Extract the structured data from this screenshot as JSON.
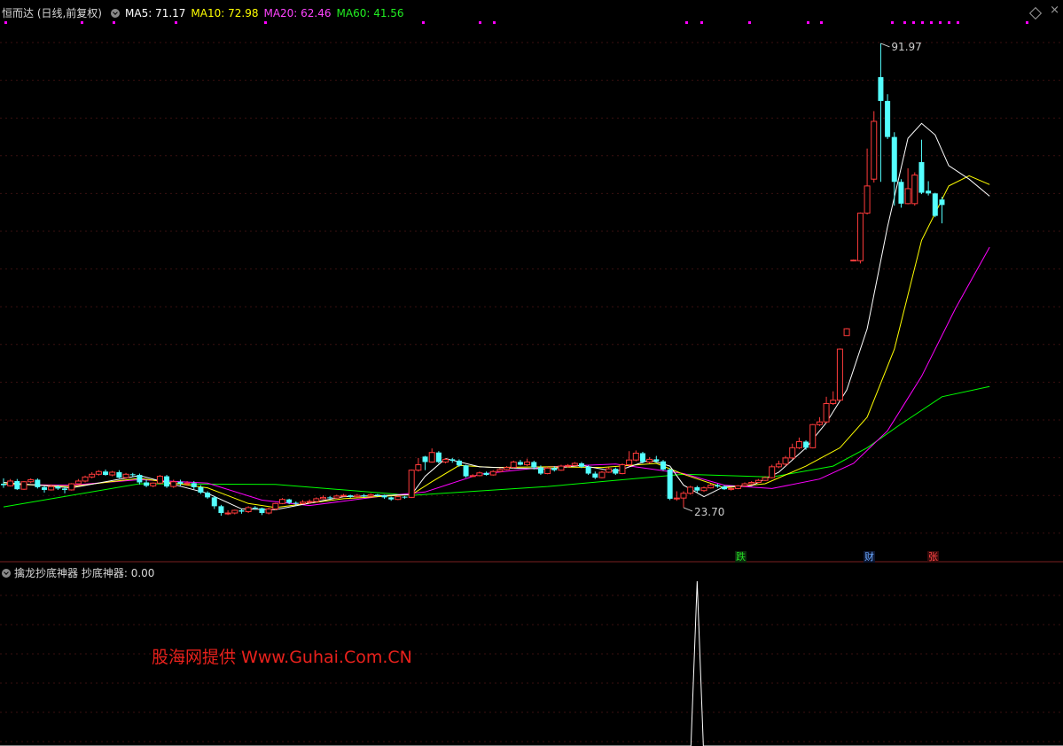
{
  "header": {
    "symbol_label": "恒而达 (日线,前复权)",
    "ma5": "MA5: 71.17",
    "ma10": "MA10: 72.98",
    "ma20": "MA20: 62.46",
    "ma60": "MA60: 41.56"
  },
  "sub_header": {
    "indicator_label": "擒龙抄底神器",
    "indicator_value": "抄底神器: 0.00"
  },
  "annotations": {
    "high_label": "91.97",
    "low_label": "23.70"
  },
  "events": [
    {
      "label": "跌",
      "color": "green"
    },
    {
      "label": "财",
      "color": "blue"
    },
    {
      "label": "张",
      "color": "red"
    }
  ],
  "watermark": "股海网提供 Www.Guhai.Com.CN",
  "icons": [
    "collapse-circle-icon",
    "diamond-icon",
    "close-x-icon"
  ],
  "colors": {
    "background": "#000000",
    "up_candle": "#ff3b3b",
    "down_candle": "#54ffff",
    "ma5": "#ffffff",
    "ma10": "#ffff00",
    "ma20": "#ff00ff",
    "ma60": "#00ff00",
    "indicator": "#ffffff",
    "marker": "#ff00ff"
  },
  "chart_data": {
    "type": "candlestick",
    "y_range": [
      16,
      96
    ],
    "high": 91.97,
    "low": 23.7,
    "candles": [
      [
        27.2,
        27.0,
        28.0,
        26.6
      ],
      [
        26.9,
        27.6,
        27.9,
        26.8
      ],
      [
        27.6,
        26.4,
        27.9,
        26.3
      ],
      [
        26.4,
        27.5,
        27.6,
        26.3
      ],
      [
        27.5,
        27.8,
        28.0,
        27.3
      ],
      [
        27.8,
        26.7,
        28.0,
        26.5
      ],
      [
        26.7,
        26.3,
        26.9,
        25.9
      ],
      [
        26.3,
        26.8,
        27.1,
        26.2
      ],
      [
        26.8,
        26.5,
        27.0,
        26.3
      ],
      [
        26.5,
        26.3,
        26.8,
        25.8
      ],
      [
        26.3,
        27.2,
        27.3,
        26.2
      ],
      [
        27.2,
        27.6,
        27.9,
        27.1
      ],
      [
        27.6,
        28.2,
        28.4,
        27.4
      ],
      [
        28.2,
        28.6,
        28.9,
        28.0
      ],
      [
        28.6,
        29.0,
        29.2,
        28.4
      ],
      [
        29.0,
        28.5,
        29.3,
        28.4
      ],
      [
        28.5,
        28.9,
        29.1,
        28.3
      ],
      [
        28.9,
        28.1,
        29.2,
        28.0
      ],
      [
        28.1,
        28.6,
        28.8,
        27.9
      ],
      [
        28.6,
        28.5,
        28.8,
        28.2
      ],
      [
        28.5,
        27.4,
        28.7,
        27.1
      ],
      [
        27.4,
        26.9,
        27.8,
        26.7
      ],
      [
        26.9,
        27.3,
        27.4,
        26.7
      ],
      [
        27.3,
        28.3,
        28.5,
        27.1
      ],
      [
        28.3,
        26.8,
        28.5,
        26.6
      ],
      [
        26.8,
        27.5,
        27.8,
        26.6
      ],
      [
        27.5,
        27.2,
        27.8,
        26.9
      ],
      [
        27.2,
        27.3,
        27.6,
        26.9
      ],
      [
        27.3,
        26.7,
        27.6,
        26.4
      ],
      [
        26.7,
        25.9,
        27.0,
        25.7
      ],
      [
        25.9,
        25.2,
        26.1,
        25.0
      ],
      [
        25.2,
        23.9,
        25.4,
        23.5
      ],
      [
        23.9,
        22.9,
        24.1,
        22.5
      ],
      [
        22.9,
        22.9,
        23.3,
        22.6
      ],
      [
        22.9,
        23.3,
        23.4,
        22.7
      ],
      [
        23.3,
        23.1,
        23.5,
        22.8
      ],
      [
        23.1,
        23.7,
        23.9,
        22.9
      ],
      [
        23.7,
        23.6,
        23.9,
        23.4
      ],
      [
        23.6,
        22.9,
        23.7,
        22.6
      ],
      [
        22.9,
        23.5,
        23.7,
        22.7
      ],
      [
        23.5,
        24.3,
        24.4,
        23.3
      ],
      [
        24.3,
        24.9,
        25.1,
        24.2
      ],
      [
        24.9,
        24.4,
        25.0,
        24.2
      ],
      [
        24.4,
        24.3,
        24.6,
        24.0
      ],
      [
        24.3,
        24.5,
        24.8,
        24.2
      ],
      [
        24.5,
        24.6,
        24.9,
        24.3
      ],
      [
        24.6,
        25.0,
        25.2,
        24.4
      ],
      [
        25.0,
        25.2,
        25.5,
        24.9
      ],
      [
        25.2,
        25.1,
        25.4,
        24.8
      ],
      [
        25.1,
        25.4,
        25.6,
        25.0
      ],
      [
        25.4,
        25.5,
        25.7,
        25.3
      ],
      [
        25.5,
        25.3,
        25.6,
        25.1
      ],
      [
        25.3,
        25.5,
        25.7,
        25.2
      ],
      [
        25.5,
        25.4,
        25.7,
        25.2
      ],
      [
        25.4,
        25.6,
        25.8,
        25.3
      ],
      [
        25.6,
        25.5,
        25.7,
        25.3
      ],
      [
        25.5,
        25.2,
        25.6,
        25.0
      ],
      [
        25.2,
        24.9,
        25.3,
        24.7
      ],
      [
        24.9,
        25.3,
        25.5,
        24.8
      ],
      [
        25.3,
        25.2,
        25.4,
        25.0
      ],
      [
        25.2,
        29.2,
        29.3,
        25.1
      ],
      [
        29.2,
        30.0,
        31.0,
        29.0
      ],
      [
        31.2,
        30.4,
        31.3,
        29.2
      ],
      [
        30.4,
        31.8,
        32.4,
        30.3
      ],
      [
        31.8,
        30.4,
        32.0,
        30.2
      ],
      [
        30.4,
        30.8,
        31.0,
        30.2
      ],
      [
        30.8,
        30.6,
        31.0,
        30.3
      ],
      [
        30.6,
        29.9,
        30.8,
        29.7
      ],
      [
        29.9,
        28.3,
        30.0,
        28.1
      ],
      [
        28.3,
        28.4,
        28.6,
        28.2
      ],
      [
        28.4,
        28.8,
        29.0,
        28.3
      ],
      [
        28.8,
        28.5,
        29.0,
        28.4
      ],
      [
        28.5,
        29.0,
        29.2,
        28.4
      ],
      [
        29.0,
        29.3,
        29.5,
        28.9
      ],
      [
        29.3,
        29.6,
        29.8,
        29.2
      ],
      [
        29.6,
        30.4,
        30.6,
        29.5
      ],
      [
        30.4,
        30.0,
        30.7,
        29.9
      ],
      [
        30.0,
        30.4,
        30.9,
        29.8
      ],
      [
        30.4,
        29.6,
        30.6,
        29.3
      ],
      [
        29.6,
        28.7,
        29.9,
        28.5
      ],
      [
        28.7,
        29.5,
        29.7,
        28.6
      ],
      [
        29.5,
        29.2,
        29.8,
        29.0
      ],
      [
        29.2,
        29.8,
        30.0,
        29.1
      ],
      [
        29.8,
        29.9,
        30.1,
        29.6
      ],
      [
        29.9,
        30.2,
        30.4,
        29.8
      ],
      [
        30.2,
        29.7,
        30.4,
        29.5
      ],
      [
        29.7,
        28.7,
        29.9,
        28.5
      ],
      [
        28.7,
        28.1,
        29.0,
        27.9
      ],
      [
        28.1,
        28.9,
        29.1,
        28.0
      ],
      [
        28.9,
        29.4,
        29.6,
        28.8
      ],
      [
        29.4,
        28.7,
        29.6,
        28.5
      ],
      [
        28.7,
        30.0,
        30.2,
        28.6
      ],
      [
        30.0,
        30.7,
        32.0,
        29.8
      ],
      [
        30.7,
        31.7,
        32.1,
        30.5
      ],
      [
        31.7,
        30.4,
        31.9,
        30.2
      ],
      [
        30.4,
        30.8,
        31.1,
        30.2
      ],
      [
        30.8,
        30.5,
        31.3,
        30.3
      ],
      [
        30.5,
        29.3,
        30.7,
        29.1
      ],
      [
        29.3,
        25.0,
        29.5,
        24.8
      ],
      [
        25.0,
        25.1,
        26.1,
        24.7
      ],
      [
        25.1,
        25.8,
        26.1,
        23.7
      ],
      [
        25.8,
        26.7,
        26.9,
        25.6
      ],
      [
        26.7,
        26.2,
        26.9,
        25.9
      ],
      [
        26.2,
        26.6,
        26.8,
        26.0
      ],
      [
        26.6,
        27.0,
        27.2,
        26.5
      ],
      [
        27.0,
        26.8,
        27.2,
        26.6
      ],
      [
        26.8,
        26.4,
        27.0,
        26.3
      ],
      [
        26.4,
        26.5,
        26.7,
        26.2
      ],
      [
        26.5,
        26.9,
        27.0,
        26.4
      ],
      [
        26.9,
        27.2,
        27.4,
        26.7
      ],
      [
        27.2,
        27.4,
        27.6,
        27.0
      ],
      [
        27.4,
        27.7,
        27.9,
        27.3
      ],
      [
        27.7,
        28.1,
        28.3,
        27.6
      ],
      [
        28.1,
        29.7,
        30.0,
        28.0
      ],
      [
        29.7,
        30.1,
        30.6,
        29.5
      ],
      [
        30.1,
        31.0,
        31.3,
        29.8
      ],
      [
        31.0,
        32.5,
        33.1,
        30.8
      ],
      [
        32.5,
        33.4,
        34.0,
        32.3
      ],
      [
        33.4,
        32.5,
        33.6,
        32.2
      ],
      [
        32.5,
        35.9,
        36.0,
        32.4
      ],
      [
        35.9,
        36.3,
        37.0,
        35.7
      ],
      [
        36.3,
        39.0,
        40.0,
        36.1
      ],
      [
        39.0,
        39.5,
        40.8,
        38.8
      ],
      [
        39.5,
        47.0,
        47.1,
        39.4
      ],
      [
        49.0,
        50.0,
        50.1,
        49.9
      ],
      [
        60.0,
        60.1,
        60.2,
        59.9
      ],
      [
        60.0,
        67.0,
        67.1,
        59.6
      ],
      [
        67.0,
        71.0,
        76.5,
        66.8
      ],
      [
        72.0,
        80.5,
        82.0,
        71.5
      ],
      [
        87.0,
        83.5,
        91.97,
        71.6
      ],
      [
        83.5,
        78.2,
        84.5,
        77.9
      ],
      [
        78.2,
        71.6,
        78.9,
        68.1
      ],
      [
        71.6,
        68.4,
        72.0,
        67.8
      ],
      [
        68.4,
        70.6,
        73.6,
        68.3
      ],
      [
        68.4,
        72.6,
        73.0,
        68.1
      ],
      [
        74.5,
        70.0,
        77.8,
        69.8
      ],
      [
        70.3,
        69.9,
        71.7,
        69.6
      ],
      [
        69.9,
        66.6,
        70.0,
        66.4
      ],
      [
        69.0,
        68.2,
        69.4,
        65.5
      ]
    ],
    "ma5": [
      [
        0,
        27.4
      ],
      [
        10,
        26.6
      ],
      [
        20,
        28.4
      ],
      [
        30,
        25.8
      ],
      [
        35,
        23.5
      ],
      [
        40,
        23.4
      ],
      [
        50,
        25.3
      ],
      [
        60,
        25.6
      ],
      [
        62,
        28.3
      ],
      [
        65,
        30.9
      ],
      [
        70,
        29.7
      ],
      [
        75,
        29.5
      ],
      [
        80,
        29.4
      ],
      [
        85,
        29.9
      ],
      [
        90,
        29.0
      ],
      [
        95,
        30.7
      ],
      [
        98,
        29.8
      ],
      [
        100,
        27.0
      ],
      [
        103,
        25.3
      ],
      [
        106,
        26.8
      ],
      [
        110,
        26.9
      ],
      [
        114,
        28.9
      ],
      [
        118,
        32.5
      ],
      [
        121,
        36.2
      ],
      [
        124,
        41.0
      ],
      [
        127,
        50.0
      ],
      [
        130,
        65.0
      ],
      [
        133,
        78.0
      ],
      [
        135,
        80.2
      ],
      [
        137,
        78.5
      ],
      [
        139,
        74.0
      ],
      [
        142,
        72.0
      ],
      [
        145,
        69.5
      ]
    ],
    "ma10": [
      [
        0,
        27.2
      ],
      [
        10,
        26.8
      ],
      [
        20,
        28.0
      ],
      [
        30,
        26.6
      ],
      [
        36,
        24.3
      ],
      [
        40,
        23.7
      ],
      [
        50,
        25.0
      ],
      [
        60,
        25.6
      ],
      [
        63,
        27.5
      ],
      [
        67,
        29.9
      ],
      [
        72,
        29.6
      ],
      [
        80,
        29.7
      ],
      [
        88,
        29.6
      ],
      [
        96,
        30.2
      ],
      [
        100,
        28.6
      ],
      [
        106,
        26.6
      ],
      [
        112,
        27.2
      ],
      [
        118,
        29.8
      ],
      [
        123,
        32.5
      ],
      [
        127,
        37.0
      ],
      [
        131,
        47.0
      ],
      [
        135,
        63.0
      ],
      [
        139,
        71.0
      ],
      [
        142,
        72.5
      ],
      [
        145,
        71.2
      ]
    ],
    "ma20": [
      [
        0,
        27.1
      ],
      [
        10,
        27.0
      ],
      [
        20,
        27.8
      ],
      [
        30,
        27.3
      ],
      [
        38,
        24.8
      ],
      [
        45,
        24.0
      ],
      [
        55,
        25.3
      ],
      [
        62,
        26.0
      ],
      [
        70,
        28.6
      ],
      [
        80,
        29.7
      ],
      [
        90,
        30.1
      ],
      [
        100,
        28.7
      ],
      [
        106,
        27.0
      ],
      [
        113,
        26.5
      ],
      [
        120,
        27.9
      ],
      [
        125,
        30.2
      ],
      [
        130,
        35.0
      ],
      [
        135,
        43.0
      ],
      [
        140,
        53.0
      ],
      [
        145,
        62.0
      ]
    ],
    "ma60": [
      [
        0,
        23.8
      ],
      [
        20,
        27.2
      ],
      [
        40,
        27.1
      ],
      [
        60,
        25.5
      ],
      [
        80,
        26.8
      ],
      [
        100,
        28.6
      ],
      [
        113,
        28.2
      ],
      [
        122,
        29.8
      ],
      [
        127,
        32.5
      ],
      [
        132,
        36.0
      ],
      [
        138,
        40.0
      ],
      [
        145,
        41.5
      ]
    ],
    "bottom_indicator": {
      "name": "抄底神器",
      "value": 0.0,
      "spike_at_index": 102,
      "spike_value": 1.0
    },
    "event_indices": [
      101,
      119,
      127
    ]
  }
}
